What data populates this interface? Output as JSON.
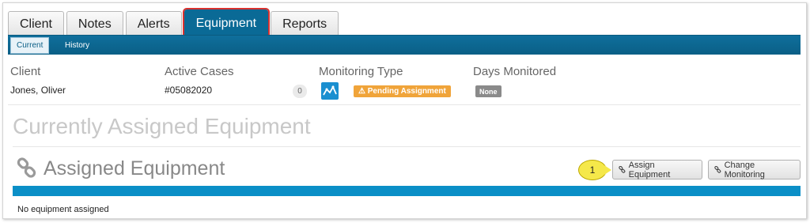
{
  "tabs": [
    {
      "label": "Client"
    },
    {
      "label": "Notes"
    },
    {
      "label": "Alerts"
    },
    {
      "label": "Equipment"
    },
    {
      "label": "Reports"
    }
  ],
  "subtabs": {
    "current": "Current",
    "history": "History"
  },
  "info": {
    "client_label": "Client",
    "client_value": "Jones, Oliver",
    "cases_label": "Active Cases",
    "cases_value": "#05082020",
    "cases_count": "0",
    "monitoring_label": "Monitoring Type",
    "monitoring_badge": "⚠ Pending Assignment",
    "days_label": "Days Monitored",
    "days_value": "None"
  },
  "page_title": "Currently Assigned Equipment",
  "section": {
    "title": "Assigned Equipment",
    "callout": "1",
    "assign_button": "Assign Equipment",
    "change_button": "Change Monitoring",
    "empty_text": "No equipment assigned"
  },
  "colors": {
    "primary": "#0a6a96",
    "table_header": "#0b8fc7",
    "pending": "#f0a43a",
    "highlight": "#d9322f",
    "callout": "#f5e84a"
  }
}
